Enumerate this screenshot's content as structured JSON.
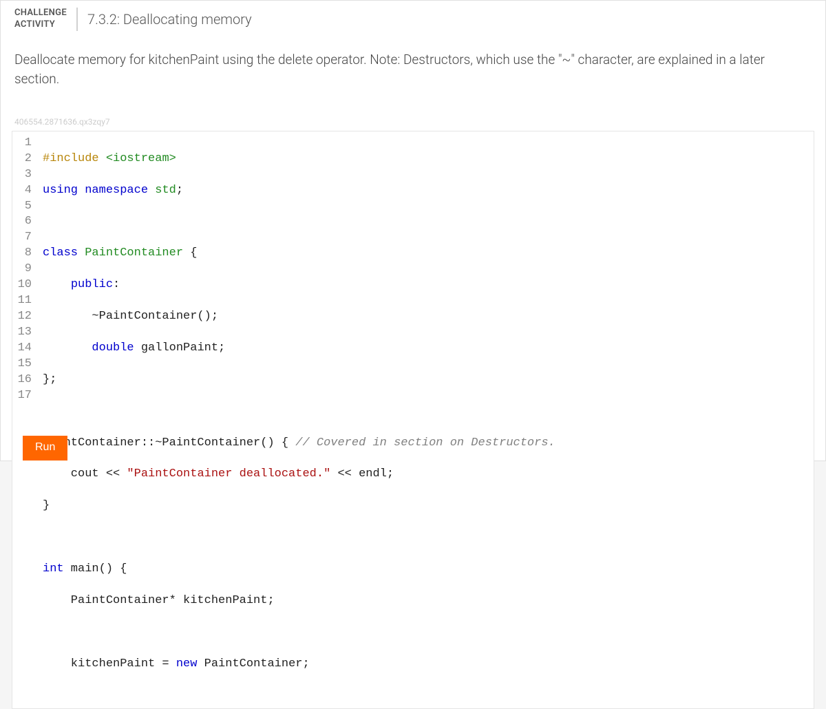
{
  "header": {
    "activity_label_line1": "CHALLENGE",
    "activity_label_line2": "ACTIVITY",
    "title": "7.3.2: Deallocating memory"
  },
  "instructions": "Deallocate memory for kitchenPaint using the delete operator. Note: Destructors, which use the \"~\" character, are explained in a later section.",
  "watermark": "406554.2871636.qx3zqy7",
  "code": {
    "line_count": 17,
    "lines": {
      "l1_a": "#include ",
      "l1_b": "<iostream>",
      "l2_a": "using ",
      "l2_b": "namespace ",
      "l2_c": "std",
      "l2_d": ";",
      "l3": "",
      "l4_a": "class ",
      "l4_b": "PaintContainer",
      "l4_c": " {",
      "l5_a": "    ",
      "l5_b": "public",
      "l5_c": ":",
      "l6": "       ~PaintContainer();",
      "l7_a": "       ",
      "l7_b": "double",
      "l7_c": " gallonPaint;",
      "l8": "};",
      "l9": "",
      "l10_a": "PaintContainer::~PaintContainer() { ",
      "l10_b": "// Covered in section on Destructors.",
      "l11_a": "    cout << ",
      "l11_b": "\"PaintContainer deallocated.\"",
      "l11_c": " << endl;",
      "l12": "}",
      "l13": "",
      "l14_a": "int",
      "l14_b": " main() {",
      "l15": "    PaintContainer* kitchenPaint;",
      "l16": "",
      "l17_a": "    kitchenPaint = ",
      "l17_b": "new",
      "l17_c": " PaintContainer;"
    }
  },
  "run_label": "Run"
}
